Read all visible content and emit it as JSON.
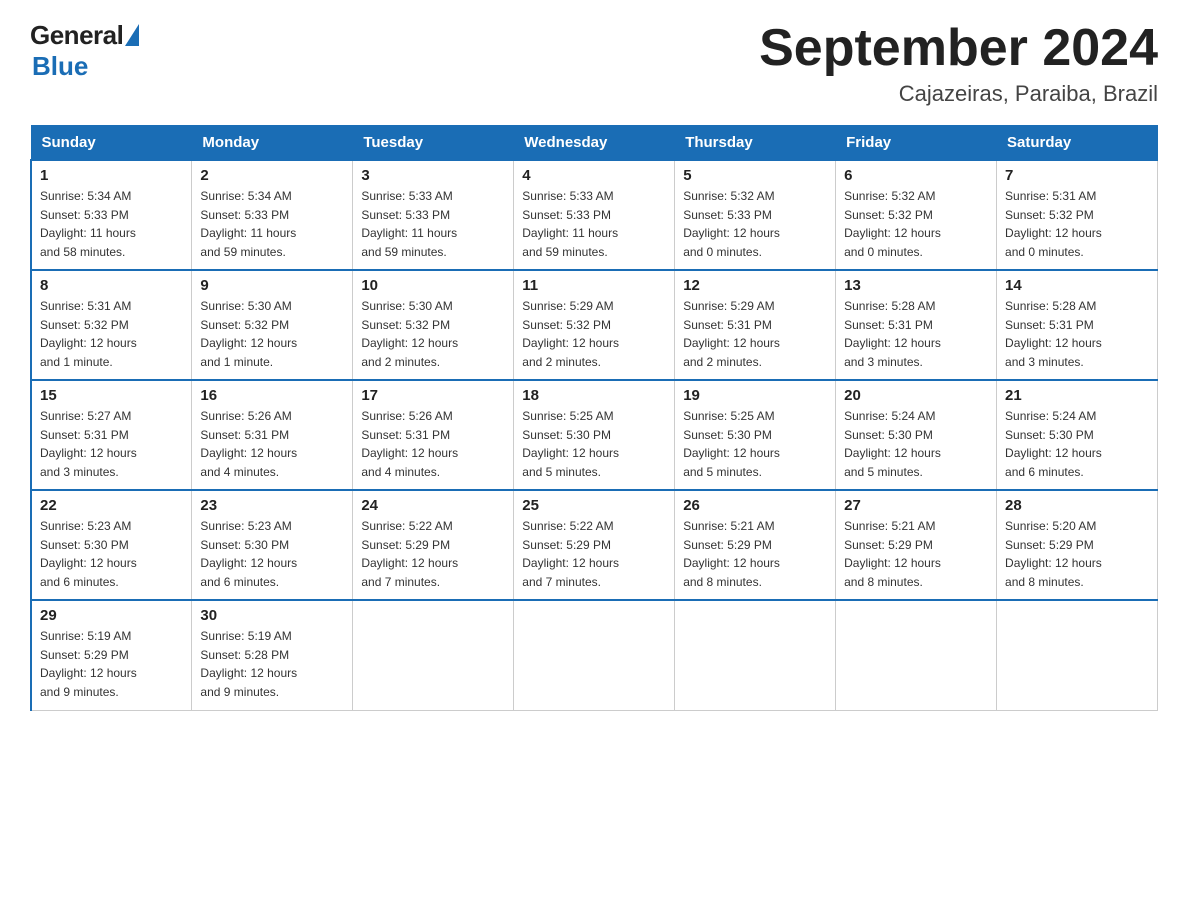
{
  "logo": {
    "general": "General",
    "blue": "Blue",
    "tagline": "Blue"
  },
  "title": "September 2024",
  "subtitle": "Cajazeiras, Paraiba, Brazil",
  "days_of_week": [
    "Sunday",
    "Monday",
    "Tuesday",
    "Wednesday",
    "Thursday",
    "Friday",
    "Saturday"
  ],
  "weeks": [
    [
      {
        "day": "1",
        "info": "Sunrise: 5:34 AM\nSunset: 5:33 PM\nDaylight: 11 hours\nand 58 minutes."
      },
      {
        "day": "2",
        "info": "Sunrise: 5:34 AM\nSunset: 5:33 PM\nDaylight: 11 hours\nand 59 minutes."
      },
      {
        "day": "3",
        "info": "Sunrise: 5:33 AM\nSunset: 5:33 PM\nDaylight: 11 hours\nand 59 minutes."
      },
      {
        "day": "4",
        "info": "Sunrise: 5:33 AM\nSunset: 5:33 PM\nDaylight: 11 hours\nand 59 minutes."
      },
      {
        "day": "5",
        "info": "Sunrise: 5:32 AM\nSunset: 5:33 PM\nDaylight: 12 hours\nand 0 minutes."
      },
      {
        "day": "6",
        "info": "Sunrise: 5:32 AM\nSunset: 5:32 PM\nDaylight: 12 hours\nand 0 minutes."
      },
      {
        "day": "7",
        "info": "Sunrise: 5:31 AM\nSunset: 5:32 PM\nDaylight: 12 hours\nand 0 minutes."
      }
    ],
    [
      {
        "day": "8",
        "info": "Sunrise: 5:31 AM\nSunset: 5:32 PM\nDaylight: 12 hours\nand 1 minute."
      },
      {
        "day": "9",
        "info": "Sunrise: 5:30 AM\nSunset: 5:32 PM\nDaylight: 12 hours\nand 1 minute."
      },
      {
        "day": "10",
        "info": "Sunrise: 5:30 AM\nSunset: 5:32 PM\nDaylight: 12 hours\nand 2 minutes."
      },
      {
        "day": "11",
        "info": "Sunrise: 5:29 AM\nSunset: 5:32 PM\nDaylight: 12 hours\nand 2 minutes."
      },
      {
        "day": "12",
        "info": "Sunrise: 5:29 AM\nSunset: 5:31 PM\nDaylight: 12 hours\nand 2 minutes."
      },
      {
        "day": "13",
        "info": "Sunrise: 5:28 AM\nSunset: 5:31 PM\nDaylight: 12 hours\nand 3 minutes."
      },
      {
        "day": "14",
        "info": "Sunrise: 5:28 AM\nSunset: 5:31 PM\nDaylight: 12 hours\nand 3 minutes."
      }
    ],
    [
      {
        "day": "15",
        "info": "Sunrise: 5:27 AM\nSunset: 5:31 PM\nDaylight: 12 hours\nand 3 minutes."
      },
      {
        "day": "16",
        "info": "Sunrise: 5:26 AM\nSunset: 5:31 PM\nDaylight: 12 hours\nand 4 minutes."
      },
      {
        "day": "17",
        "info": "Sunrise: 5:26 AM\nSunset: 5:31 PM\nDaylight: 12 hours\nand 4 minutes."
      },
      {
        "day": "18",
        "info": "Sunrise: 5:25 AM\nSunset: 5:30 PM\nDaylight: 12 hours\nand 5 minutes."
      },
      {
        "day": "19",
        "info": "Sunrise: 5:25 AM\nSunset: 5:30 PM\nDaylight: 12 hours\nand 5 minutes."
      },
      {
        "day": "20",
        "info": "Sunrise: 5:24 AM\nSunset: 5:30 PM\nDaylight: 12 hours\nand 5 minutes."
      },
      {
        "day": "21",
        "info": "Sunrise: 5:24 AM\nSunset: 5:30 PM\nDaylight: 12 hours\nand 6 minutes."
      }
    ],
    [
      {
        "day": "22",
        "info": "Sunrise: 5:23 AM\nSunset: 5:30 PM\nDaylight: 12 hours\nand 6 minutes."
      },
      {
        "day": "23",
        "info": "Sunrise: 5:23 AM\nSunset: 5:30 PM\nDaylight: 12 hours\nand 6 minutes."
      },
      {
        "day": "24",
        "info": "Sunrise: 5:22 AM\nSunset: 5:29 PM\nDaylight: 12 hours\nand 7 minutes."
      },
      {
        "day": "25",
        "info": "Sunrise: 5:22 AM\nSunset: 5:29 PM\nDaylight: 12 hours\nand 7 minutes."
      },
      {
        "day": "26",
        "info": "Sunrise: 5:21 AM\nSunset: 5:29 PM\nDaylight: 12 hours\nand 8 minutes."
      },
      {
        "day": "27",
        "info": "Sunrise: 5:21 AM\nSunset: 5:29 PM\nDaylight: 12 hours\nand 8 minutes."
      },
      {
        "day": "28",
        "info": "Sunrise: 5:20 AM\nSunset: 5:29 PM\nDaylight: 12 hours\nand 8 minutes."
      }
    ],
    [
      {
        "day": "29",
        "info": "Sunrise: 5:19 AM\nSunset: 5:29 PM\nDaylight: 12 hours\nand 9 minutes."
      },
      {
        "day": "30",
        "info": "Sunrise: 5:19 AM\nSunset: 5:28 PM\nDaylight: 12 hours\nand 9 minutes."
      },
      null,
      null,
      null,
      null,
      null
    ]
  ]
}
